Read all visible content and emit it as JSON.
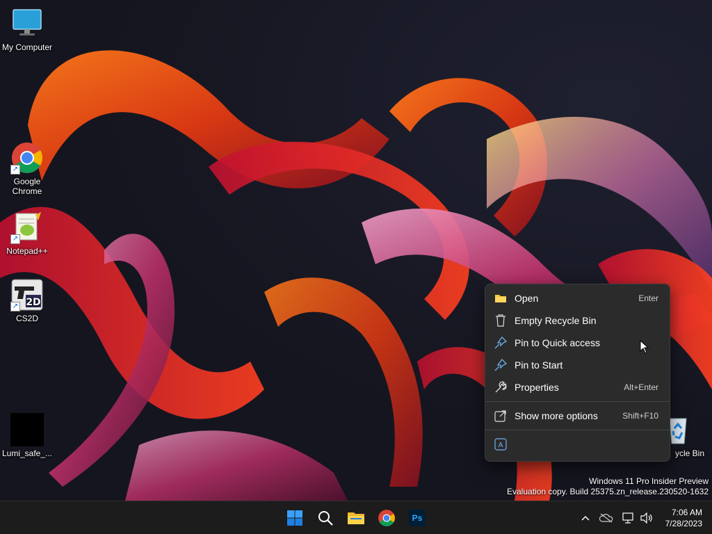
{
  "desktop": {
    "icons": [
      {
        "label": "My Computer",
        "icon": "monitor-icon"
      },
      {
        "label": "Google Chrome",
        "icon": "chrome-icon"
      },
      {
        "label": "Notepad++",
        "icon": "notepadpp-icon"
      },
      {
        "label": "CS2D",
        "icon": "cs2d-icon"
      },
      {
        "label": "Lumi_safe_...",
        "icon": "black-file-icon"
      },
      {
        "label": "Recycle Bin",
        "visible_label": "ycle Bin",
        "icon": "recycle-bin-icon"
      }
    ]
  },
  "context_menu": {
    "items": [
      {
        "label": "Open",
        "shortcut": "Enter",
        "icon": "folder-icon"
      },
      {
        "label": "Empty Recycle Bin",
        "shortcut": "",
        "icon": "trash-icon"
      },
      {
        "label": "Pin to Quick access",
        "shortcut": "",
        "icon": "pin-icon"
      },
      {
        "label": "Pin to Start",
        "shortcut": "",
        "icon": "pin-icon"
      },
      {
        "label": "Properties",
        "shortcut": "Alt+Enter",
        "icon": "wrench-icon"
      },
      {
        "label": "Show more options",
        "shortcut": "Shift+F10",
        "icon": "share-icon"
      }
    ],
    "bottom_icon": "translate-icon"
  },
  "watermark": {
    "line1": "Windows 11 Pro Insider Preview",
    "line2": "Evaluation copy. Build 25375.zn_release.230520-1632"
  },
  "taskbar": {
    "apps": [
      "start-icon",
      "search-icon",
      "file-explorer-icon",
      "chrome-icon",
      "photoshop-icon"
    ],
    "ps_label": "Ps",
    "tray": [
      "chevron-up-icon",
      "onedrive-icon",
      "network-icon",
      "volume-icon"
    ],
    "time": "7:06 AM",
    "date": "7/28/2023"
  },
  "colors": {
    "menu_bg": "#2b2b2b",
    "taskbar_bg": "#1c1c1c",
    "accent": "#0078d4"
  }
}
